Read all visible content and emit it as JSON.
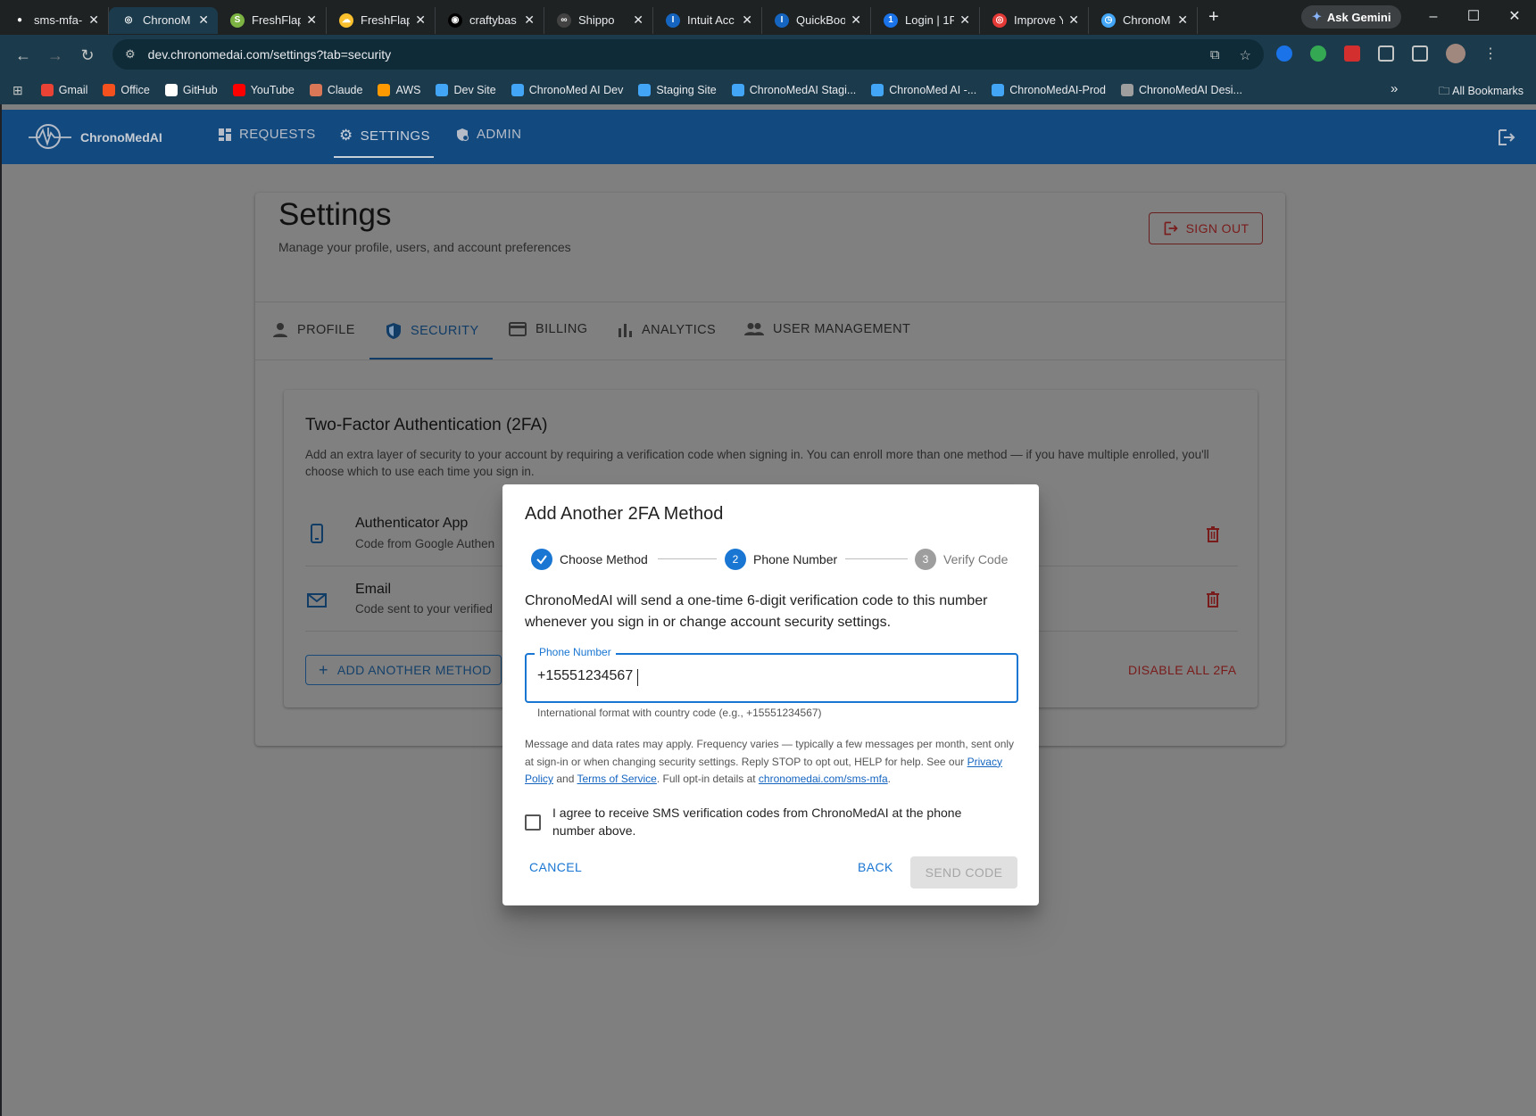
{
  "browser": {
    "tabs": [
      {
        "title": "sms-mfa-",
        "color": "#1f2223",
        "glyph": "●"
      },
      {
        "title": "ChronoM",
        "color": "#1b3a4b",
        "glyph": "◎",
        "active": true
      },
      {
        "title": "FreshFlap",
        "color": "#7cb342",
        "glyph": "S"
      },
      {
        "title": "FreshFlap",
        "color": "#fbc02d",
        "glyph": "☁"
      },
      {
        "title": "craftybas",
        "color": "#000000",
        "glyph": "◉"
      },
      {
        "title": "Shippo",
        "color": "#424242",
        "glyph": "∞"
      },
      {
        "title": "Intuit Acc",
        "color": "#1565c0",
        "glyph": "I"
      },
      {
        "title": "QuickBoo",
        "color": "#1565c0",
        "glyph": "I"
      },
      {
        "title": "Login | 1P",
        "color": "#1a73e8",
        "glyph": "1"
      },
      {
        "title": "Improve Y",
        "color": "#e53935",
        "glyph": "◎"
      },
      {
        "title": "ChronoM",
        "color": "#42a5f5",
        "glyph": "◷"
      }
    ],
    "new_tab": "+",
    "ask_gemini": "Ask Gemini",
    "url": "dev.chronomedai.com/settings?tab=security",
    "bookmarks": [
      {
        "label": "Gmail",
        "color": "#ea4335"
      },
      {
        "label": "Office",
        "color": "#f4511e"
      },
      {
        "label": "GitHub",
        "color": "#ffffff"
      },
      {
        "label": "YouTube",
        "color": "#ff0000"
      },
      {
        "label": "Claude",
        "color": "#d97757"
      },
      {
        "label": "AWS",
        "color": "#ff9900"
      },
      {
        "label": "Dev Site",
        "color": "#42a5f5"
      },
      {
        "label": "ChronoMed AI Dev",
        "color": "#42a5f5"
      },
      {
        "label": "Staging Site",
        "color": "#42a5f5"
      },
      {
        "label": "ChronoMedAI Stagi...",
        "color": "#42a5f5"
      },
      {
        "label": "ChronoMed AI -...",
        "color": "#42a5f5"
      },
      {
        "label": "ChronoMedAI-Prod",
        "color": "#42a5f5"
      },
      {
        "label": "ChronoMedAI Desi...",
        "color": "#9e9e9e"
      }
    ],
    "all_bookmarks": "All Bookmarks"
  },
  "app": {
    "brand": "ChronoMedAI",
    "nav": [
      {
        "label": "REQUESTS",
        "icon": "dashboard-icon"
      },
      {
        "label": "SETTINGS",
        "icon": "gear-icon",
        "active": true
      },
      {
        "label": "ADMIN",
        "icon": "admin-icon"
      }
    ]
  },
  "settings": {
    "title": "Settings",
    "subtitle": "Manage your profile, users, and account preferences",
    "sign_out": "SIGN OUT",
    "tabs": [
      {
        "label": "PROFILE",
        "icon": "person-icon"
      },
      {
        "label": "SECURITY",
        "icon": "shield-icon",
        "active": true
      },
      {
        "label": "BILLING",
        "icon": "credit-card-icon"
      },
      {
        "label": "ANALYTICS",
        "icon": "bar-chart-icon"
      },
      {
        "label": "USER MANAGEMENT",
        "icon": "people-icon"
      }
    ]
  },
  "tfa": {
    "title": "Two-Factor Authentication (2FA)",
    "description": "Add an extra layer of security to your account by requiring a verification code when signing in. You can enroll more than one method — if you have multiple enrolled, you'll choose which to use each time you sign in.",
    "methods": [
      {
        "name": "Authenticator App",
        "desc": "Code from Google Authen",
        "icon": "phone-icon"
      },
      {
        "name": "Email",
        "desc": "Code sent to your verified",
        "icon": "mail-icon"
      }
    ],
    "add_method": "ADD ANOTHER METHOD",
    "disable_all": "DISABLE ALL 2FA"
  },
  "dialog": {
    "title": "Add Another 2FA Method",
    "steps": [
      {
        "label": "Choose Method",
        "number": "1",
        "state": "done"
      },
      {
        "label": "Phone Number",
        "number": "2",
        "state": "active"
      },
      {
        "label": "Verify Code",
        "number": "3",
        "state": "pending"
      }
    ],
    "body": "ChronoMedAI will send a one-time 6-digit verification code to this number whenever you sign in or change account security settings.",
    "phone_label": "Phone Number",
    "phone_value": "+15551234567",
    "helper": "International format with country code (e.g., +15551234567)",
    "legal_1": "Message and data rates may apply. Frequency varies — typically a few messages per month, sent only at sign-in or when changing security settings. Reply STOP to opt out, HELP for help. See our ",
    "privacy_policy": "Privacy Policy",
    "legal_and": " and ",
    "terms": "Terms of Service",
    "legal_2": ". Full opt-in details at ",
    "legal_link": "chronomedai.com/sms-mfa",
    "legal_end": ".",
    "consent": "I agree to receive SMS verification codes from ChronoMedAI at the phone number above.",
    "cancel": "CANCEL",
    "back": "BACK",
    "send_code": "SEND CODE"
  },
  "colors": {
    "primary": "#1976d2",
    "danger": "#c62828",
    "appbar": "#1565c0"
  }
}
